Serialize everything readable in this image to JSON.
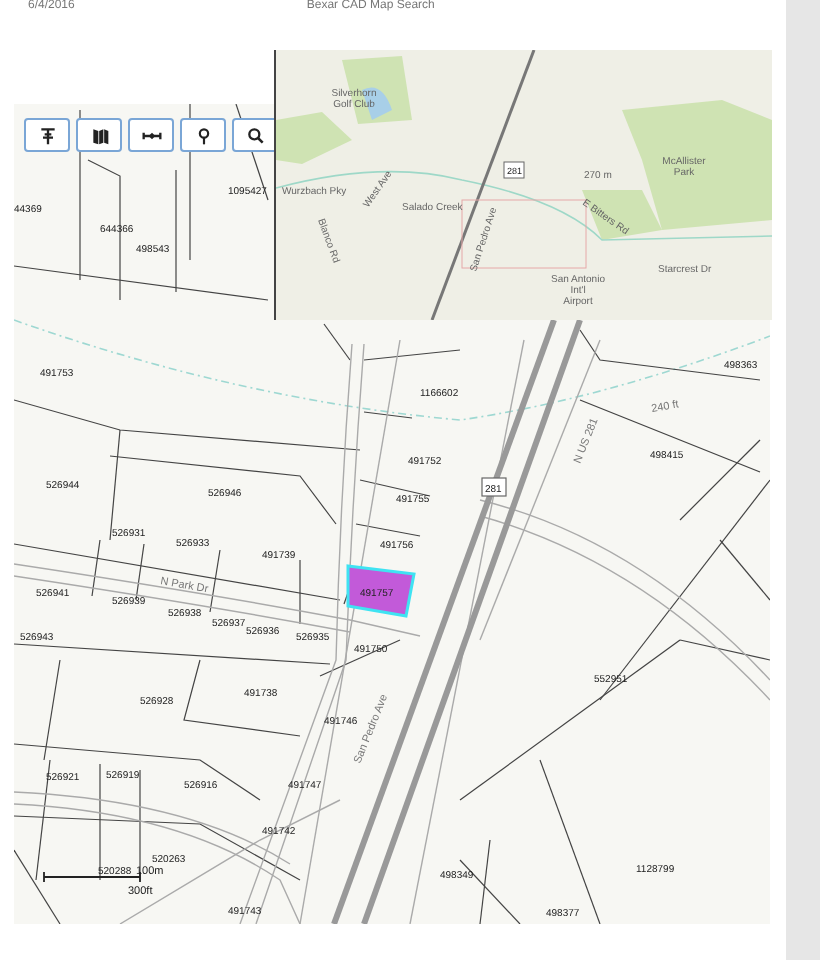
{
  "header": {
    "date": "6/4/2016",
    "title": "Bexar CAD Map Search"
  },
  "toolbar": [
    {
      "kind": "layers"
    },
    {
      "kind": "basemap"
    },
    {
      "kind": "measure"
    },
    {
      "kind": "locate"
    },
    {
      "kind": "search"
    }
  ],
  "parcels": [
    {
      "number": "1095427",
      "selected": false
    },
    {
      "number": "44369",
      "selected": false
    },
    {
      "number": "644366",
      "selected": false
    },
    {
      "number": "498543",
      "selected": false
    },
    {
      "number": "498363",
      "selected": false
    },
    {
      "number": "491753",
      "selected": false
    },
    {
      "number": "1166602",
      "selected": false
    },
    {
      "number": "498415",
      "selected": false
    },
    {
      "number": "491752",
      "selected": false
    },
    {
      "number": "526944",
      "selected": false
    },
    {
      "number": "526946",
      "selected": false
    },
    {
      "number": "491755",
      "selected": false
    },
    {
      "number": "526931",
      "selected": false
    },
    {
      "number": "526933",
      "selected": false
    },
    {
      "number": "491756",
      "selected": false
    },
    {
      "number": "491739",
      "selected": false
    },
    {
      "number": "491757",
      "selected": true
    },
    {
      "number": "526941",
      "selected": false
    },
    {
      "number": "526939",
      "selected": false
    },
    {
      "number": "526938",
      "selected": false
    },
    {
      "number": "526937",
      "selected": false
    },
    {
      "number": "526936",
      "selected": false
    },
    {
      "number": "526935",
      "selected": false
    },
    {
      "number": "526943",
      "selected": false
    },
    {
      "number": "491750",
      "selected": false
    },
    {
      "number": "552951",
      "selected": false
    },
    {
      "number": "491738",
      "selected": false
    },
    {
      "number": "526928",
      "selected": false
    },
    {
      "number": "491746",
      "selected": false
    },
    {
      "number": "526919",
      "selected": false
    },
    {
      "number": "526921",
      "selected": false
    },
    {
      "number": "526916",
      "selected": false
    },
    {
      "number": "491747",
      "selected": false
    },
    {
      "number": "491742",
      "selected": false
    },
    {
      "number": "520263",
      "selected": false
    },
    {
      "number": "1128799",
      "selected": false
    },
    {
      "number": "520288",
      "selected": false
    },
    {
      "number": "498349",
      "selected": false
    },
    {
      "number": "491743",
      "selected": false
    },
    {
      "number": "498377",
      "selected": false
    }
  ],
  "streets": [
    "N Park Dr",
    "San Pedro Ave",
    "N US 281",
    "240 ft"
  ],
  "route_shields": [
    "281"
  ],
  "scale_bar": {
    "metric": "100m",
    "imperial": "300ft"
  },
  "overview_map": {
    "labels": [
      "Silverhorn Golf Club",
      "Wurzbach Pky",
      "Salado Creek",
      "Blanco Rd",
      "West Ave",
      "San Pedro Ave",
      "270 m",
      "McAllister Park",
      "E Bitters Rd",
      "Starcrest Dr",
      "San Antonio Int'l Airport"
    ],
    "route_shield": "281"
  }
}
